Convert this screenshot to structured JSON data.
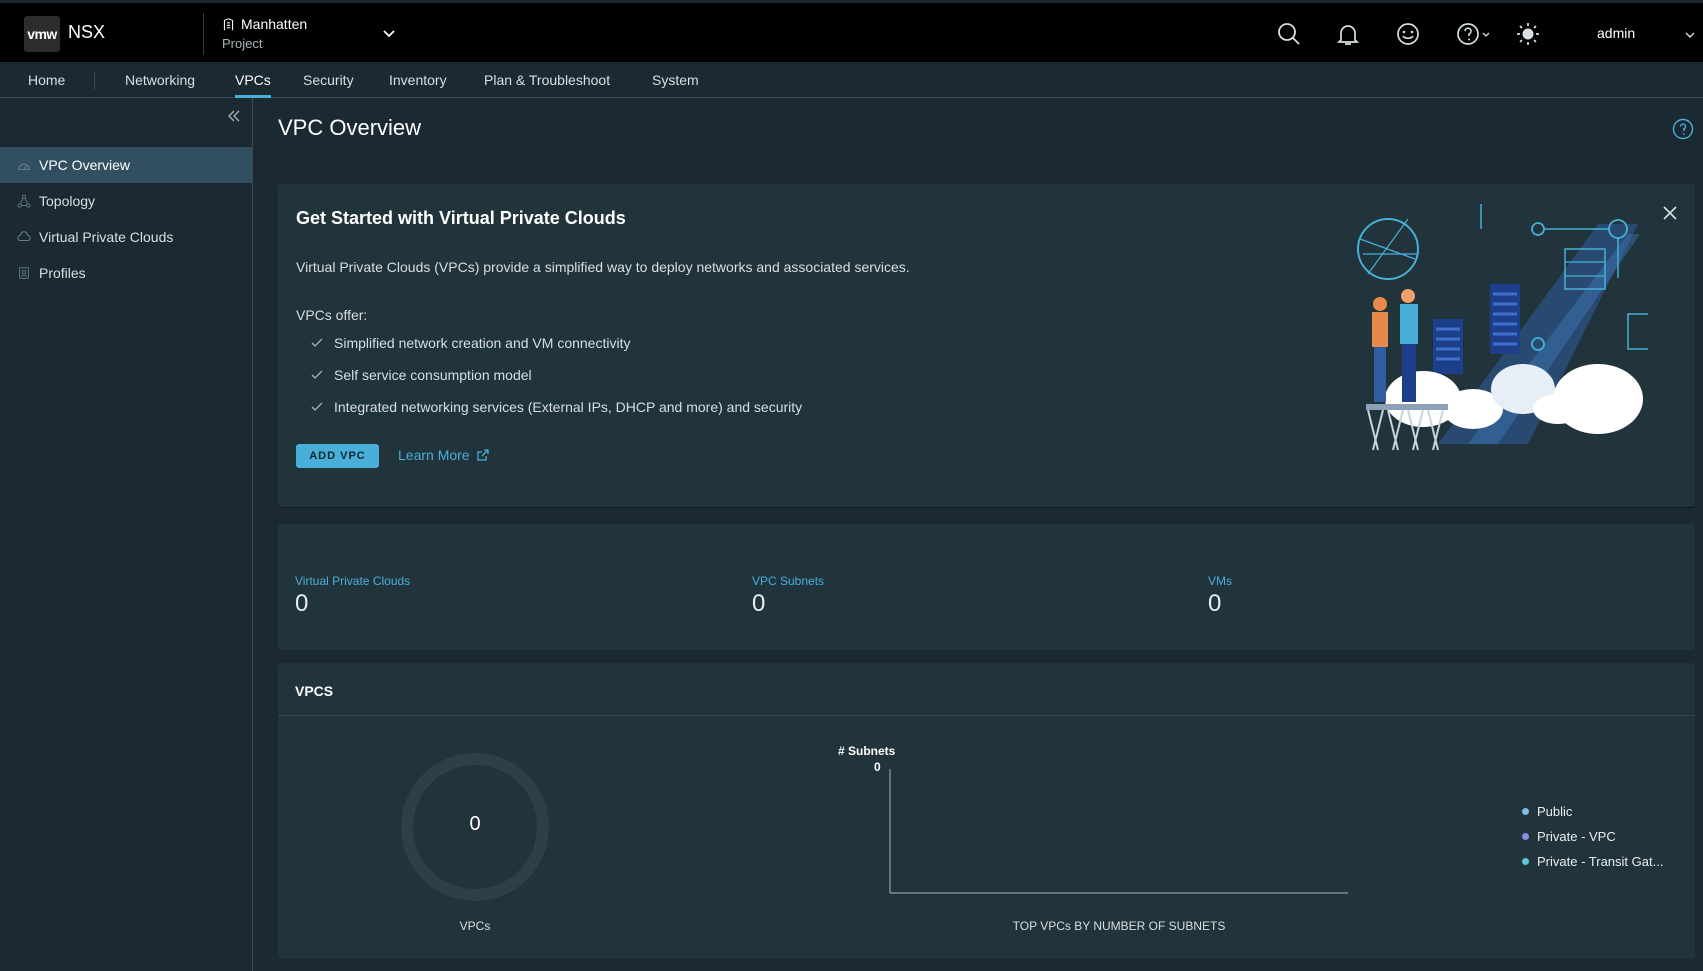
{
  "header": {
    "logo": "vmw",
    "app_name": "NSX",
    "project_name": "Manhatten",
    "project_label": "Project",
    "user": "admin"
  },
  "nav": {
    "tabs": [
      {
        "label": "Home"
      },
      {
        "label": "Networking"
      },
      {
        "label": "VPCs"
      },
      {
        "label": "Security"
      },
      {
        "label": "Inventory"
      },
      {
        "label": "Plan & Troubleshoot"
      },
      {
        "label": "System"
      }
    ],
    "active": "VPCs"
  },
  "sidebar": {
    "items": [
      {
        "label": "VPC Overview",
        "icon": "dashboard-icon"
      },
      {
        "label": "Topology",
        "icon": "topology-icon"
      },
      {
        "label": "Virtual Private Clouds",
        "icon": "cloud-icon"
      },
      {
        "label": "Profiles",
        "icon": "profile-icon"
      }
    ]
  },
  "main": {
    "title": "VPC Overview",
    "get_started": {
      "title": "Get Started with Virtual Private Clouds",
      "description": "Virtual Private Clouds (VPCs) provide a simplified way to deploy networks and associated services.",
      "offer_label": "VPCs offer:",
      "offers": [
        "Simplified network creation and VM connectivity",
        "Self service consumption model",
        "Integrated networking services (External IPs, DHCP and more) and security"
      ],
      "add_button": "ADD VPC",
      "learn_more": "Learn More"
    },
    "stats": [
      {
        "label": "Virtual Private Clouds",
        "value": "0"
      },
      {
        "label": "VPC Subnets",
        "value": "0"
      },
      {
        "label": "VMs",
        "value": "0"
      }
    ],
    "vpcs": {
      "title": "VPCS",
      "donut_value": "0",
      "donut_label": "VPCs",
      "bar_ylabel": "# Subnets",
      "bar_ytick": "0",
      "bar_title": "TOP VPCs BY NUMBER OF SUBNETS",
      "legend": [
        {
          "label": "Public",
          "color": "#7fbde6"
        },
        {
          "label": "Private - VPC",
          "color": "#8d8ee0"
        },
        {
          "label": "Private - Transit Gat...",
          "color": "#5fc6d6"
        }
      ]
    }
  },
  "colors": {
    "accent": "#49afd9",
    "background": "#1b2a32",
    "card": "#21333b",
    "header": "#000000"
  }
}
